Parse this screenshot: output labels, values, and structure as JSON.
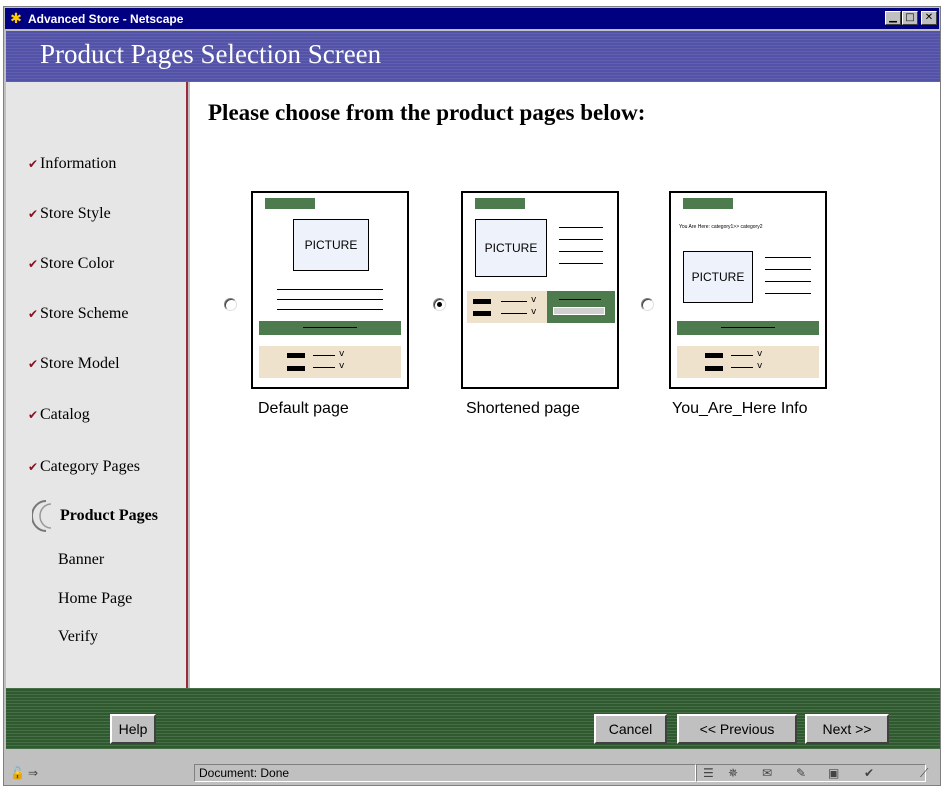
{
  "window": {
    "title": "Advanced Store - Netscape",
    "app_icon": "netscape-star-icon",
    "minimize_glyph": "▁",
    "maximize_glyph": "□",
    "close_glyph": "✕"
  },
  "header": {
    "title": "Product Pages Selection Screen"
  },
  "sidebar": {
    "check_glyph": "✔",
    "items": [
      {
        "label": "Information",
        "state": "done"
      },
      {
        "label": "Store Style",
        "state": "done"
      },
      {
        "label": "Store Color",
        "state": "done"
      },
      {
        "label": "Store Scheme",
        "state": "done"
      },
      {
        "label": "Store Model",
        "state": "done"
      },
      {
        "label": "Catalog",
        "state": "done"
      },
      {
        "label": "Category Pages",
        "state": "done"
      },
      {
        "label": "Product Pages",
        "state": "current"
      },
      {
        "label": "Banner",
        "state": "pending"
      },
      {
        "label": "Home Page",
        "state": "pending"
      },
      {
        "label": "Verify",
        "state": "pending"
      }
    ]
  },
  "main": {
    "prompt": "Please choose from the product pages below:",
    "options": [
      {
        "caption": "Default page",
        "selected": false,
        "picture_label": "PICTURE"
      },
      {
        "caption": "Shortened page",
        "selected": true,
        "picture_label": "PICTURE"
      },
      {
        "caption": "You_Are_Here Info",
        "selected": false,
        "picture_label": "PICTURE",
        "breadcrumb": "You Are Here: category1>> category2"
      }
    ],
    "dropdown_glyph": "v"
  },
  "footer": {
    "help_label": "Help",
    "cancel_label": "Cancel",
    "previous_label": "<< Previous",
    "next_label": "Next >>"
  },
  "statusbar": {
    "text": "Document: Done"
  },
  "colors": {
    "title_bar": "#000080",
    "banner": "#5252a8",
    "sidebar_bg": "#e6e6e6",
    "sidebar_border": "#9c2a3a",
    "check": "#8a1020",
    "footer": "#2f5a2f",
    "thumb_green": "#4e7b4e",
    "thumb_tan": "#efe2cc"
  }
}
